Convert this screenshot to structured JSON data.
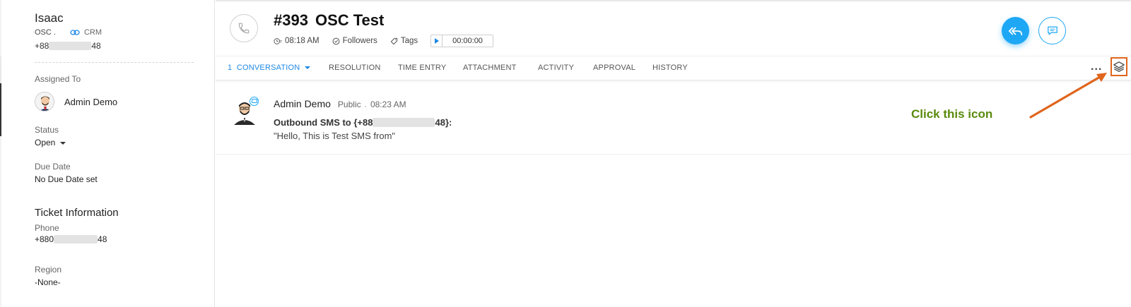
{
  "contact": {
    "name": "Isaac",
    "account": "OSC .",
    "crm_label": "CRM",
    "phone_prefix": "+88",
    "phone_suffix": "48"
  },
  "sidebar": {
    "assigned_label": "Assigned To",
    "assignee": "Admin Demo",
    "status_label": "Status",
    "status_value": "Open",
    "due_label": "Due Date",
    "due_value": "No Due Date set",
    "ticket_info_title": "Ticket Information",
    "phone_label": "Phone",
    "phone_prefix": "+880",
    "phone_suffix": "48",
    "region_label": "Region",
    "region_value": "-None-"
  },
  "ticket": {
    "number": "#393",
    "subject": "OSC Test",
    "time": "08:18 AM",
    "followers_label": "Followers",
    "tags_label": "Tags",
    "timer": "00:00:00"
  },
  "tabs": [
    {
      "label": "1  CONVERSATION",
      "active": true
    },
    {
      "label": "RESOLUTION",
      "active": false
    },
    {
      "label": "TIME ENTRY",
      "active": false
    },
    {
      "label": "ATTACHMENT",
      "active": false
    },
    {
      "label": "ACTIVITY",
      "active": false
    },
    {
      "label": "APPROVAL",
      "active": false
    },
    {
      "label": "HISTORY",
      "active": false
    }
  ],
  "more_label": "...",
  "conversation": {
    "author": "Admin Demo",
    "visibility": "Public",
    "separator": ".",
    "time": "08:23 AM",
    "line1_prefix": "Outbound SMS to {+88",
    "line1_suffix": "48}:",
    "line2": "\"Hello, This is Test SMS from\""
  },
  "annotation": {
    "text": "Click this icon"
  },
  "colors": {
    "accent": "#1ea7f5",
    "tab_active": "#1e88e5",
    "annotation_text": "#5a8a0c",
    "annotation_arrow": "#e0651c"
  },
  "icons": [
    "link-icon",
    "phone-icon",
    "clock-icon",
    "followers-icon",
    "tag-icon",
    "play-icon",
    "reply-all-icon",
    "comment-icon",
    "more-icon",
    "layers-icon",
    "sms-icon"
  ]
}
